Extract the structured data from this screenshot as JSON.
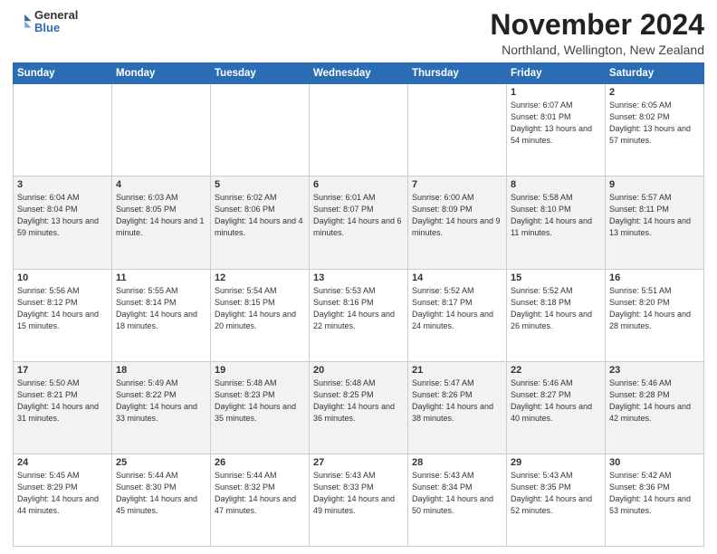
{
  "logo": {
    "general": "General",
    "blue": "Blue"
  },
  "header": {
    "month": "November 2024",
    "location": "Northland, Wellington, New Zealand"
  },
  "days_of_week": [
    "Sunday",
    "Monday",
    "Tuesday",
    "Wednesday",
    "Thursday",
    "Friday",
    "Saturday"
  ],
  "weeks": [
    [
      {
        "day": "",
        "info": ""
      },
      {
        "day": "",
        "info": ""
      },
      {
        "day": "",
        "info": ""
      },
      {
        "day": "",
        "info": ""
      },
      {
        "day": "",
        "info": ""
      },
      {
        "day": "1",
        "info": "Sunrise: 6:07 AM\nSunset: 8:01 PM\nDaylight: 13 hours\nand 54 minutes."
      },
      {
        "day": "2",
        "info": "Sunrise: 6:05 AM\nSunset: 8:02 PM\nDaylight: 13 hours\nand 57 minutes."
      }
    ],
    [
      {
        "day": "3",
        "info": "Sunrise: 6:04 AM\nSunset: 8:04 PM\nDaylight: 13 hours\nand 59 minutes."
      },
      {
        "day": "4",
        "info": "Sunrise: 6:03 AM\nSunset: 8:05 PM\nDaylight: 14 hours\nand 1 minute."
      },
      {
        "day": "5",
        "info": "Sunrise: 6:02 AM\nSunset: 8:06 PM\nDaylight: 14 hours\nand 4 minutes."
      },
      {
        "day": "6",
        "info": "Sunrise: 6:01 AM\nSunset: 8:07 PM\nDaylight: 14 hours\nand 6 minutes."
      },
      {
        "day": "7",
        "info": "Sunrise: 6:00 AM\nSunset: 8:09 PM\nDaylight: 14 hours\nand 9 minutes."
      },
      {
        "day": "8",
        "info": "Sunrise: 5:58 AM\nSunset: 8:10 PM\nDaylight: 14 hours\nand 11 minutes."
      },
      {
        "day": "9",
        "info": "Sunrise: 5:57 AM\nSunset: 8:11 PM\nDaylight: 14 hours\nand 13 minutes."
      }
    ],
    [
      {
        "day": "10",
        "info": "Sunrise: 5:56 AM\nSunset: 8:12 PM\nDaylight: 14 hours\nand 15 minutes."
      },
      {
        "day": "11",
        "info": "Sunrise: 5:55 AM\nSunset: 8:14 PM\nDaylight: 14 hours\nand 18 minutes."
      },
      {
        "day": "12",
        "info": "Sunrise: 5:54 AM\nSunset: 8:15 PM\nDaylight: 14 hours\nand 20 minutes."
      },
      {
        "day": "13",
        "info": "Sunrise: 5:53 AM\nSunset: 8:16 PM\nDaylight: 14 hours\nand 22 minutes."
      },
      {
        "day": "14",
        "info": "Sunrise: 5:52 AM\nSunset: 8:17 PM\nDaylight: 14 hours\nand 24 minutes."
      },
      {
        "day": "15",
        "info": "Sunrise: 5:52 AM\nSunset: 8:18 PM\nDaylight: 14 hours\nand 26 minutes."
      },
      {
        "day": "16",
        "info": "Sunrise: 5:51 AM\nSunset: 8:20 PM\nDaylight: 14 hours\nand 28 minutes."
      }
    ],
    [
      {
        "day": "17",
        "info": "Sunrise: 5:50 AM\nSunset: 8:21 PM\nDaylight: 14 hours\nand 31 minutes."
      },
      {
        "day": "18",
        "info": "Sunrise: 5:49 AM\nSunset: 8:22 PM\nDaylight: 14 hours\nand 33 minutes."
      },
      {
        "day": "19",
        "info": "Sunrise: 5:48 AM\nSunset: 8:23 PM\nDaylight: 14 hours\nand 35 minutes."
      },
      {
        "day": "20",
        "info": "Sunrise: 5:48 AM\nSunset: 8:25 PM\nDaylight: 14 hours\nand 36 minutes."
      },
      {
        "day": "21",
        "info": "Sunrise: 5:47 AM\nSunset: 8:26 PM\nDaylight: 14 hours\nand 38 minutes."
      },
      {
        "day": "22",
        "info": "Sunrise: 5:46 AM\nSunset: 8:27 PM\nDaylight: 14 hours\nand 40 minutes."
      },
      {
        "day": "23",
        "info": "Sunrise: 5:46 AM\nSunset: 8:28 PM\nDaylight: 14 hours\nand 42 minutes."
      }
    ],
    [
      {
        "day": "24",
        "info": "Sunrise: 5:45 AM\nSunset: 8:29 PM\nDaylight: 14 hours\nand 44 minutes."
      },
      {
        "day": "25",
        "info": "Sunrise: 5:44 AM\nSunset: 8:30 PM\nDaylight: 14 hours\nand 45 minutes."
      },
      {
        "day": "26",
        "info": "Sunrise: 5:44 AM\nSunset: 8:32 PM\nDaylight: 14 hours\nand 47 minutes."
      },
      {
        "day": "27",
        "info": "Sunrise: 5:43 AM\nSunset: 8:33 PM\nDaylight: 14 hours\nand 49 minutes."
      },
      {
        "day": "28",
        "info": "Sunrise: 5:43 AM\nSunset: 8:34 PM\nDaylight: 14 hours\nand 50 minutes."
      },
      {
        "day": "29",
        "info": "Sunrise: 5:43 AM\nSunset: 8:35 PM\nDaylight: 14 hours\nand 52 minutes."
      },
      {
        "day": "30",
        "info": "Sunrise: 5:42 AM\nSunset: 8:36 PM\nDaylight: 14 hours\nand 53 minutes."
      }
    ]
  ]
}
